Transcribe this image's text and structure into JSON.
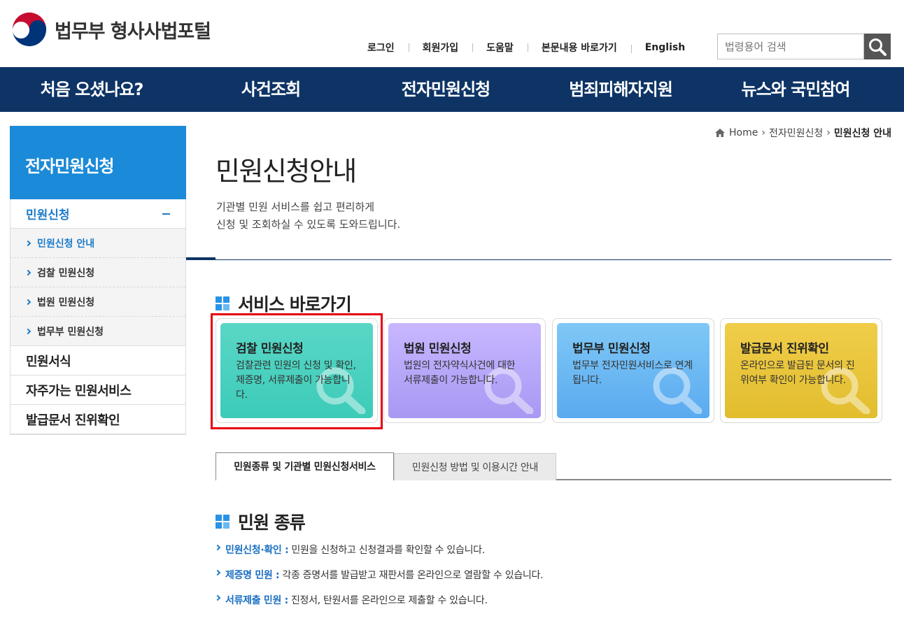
{
  "header": {
    "logo_text": "법무부 형사사법포털",
    "util_links": [
      "로그인",
      "회원가입",
      "도움말",
      "본문내용 바로가기",
      "English"
    ],
    "search_placeholder": "법령용어 검색"
  },
  "gnb": [
    "처음 오셨나요?",
    "사건조회",
    "전자민원신청",
    "범죄피해자지원",
    "뉴스와 국민참여"
  ],
  "sidebar": {
    "title": "전자민원신청",
    "group_label": "민원신청",
    "sub_items": [
      "민원신청 안내",
      "검찰 민원신청",
      "법원 민원신청",
      "법무부 민원신청"
    ],
    "main_items": [
      "민원서식",
      "자주가는 민원서비스",
      "발급문서 진위확인"
    ]
  },
  "breadcrumb": {
    "home": "Home",
    "level1": "전자민원신청",
    "current": "민원신청 안내"
  },
  "page": {
    "title": "민원신청안내",
    "desc_line1": "기관별 민원 서비스를 쉽고 편리하게",
    "desc_line2": "신청 및 조회하실 수 있도록 도와드립니다."
  },
  "services": {
    "section_title": "서비스 바로가기",
    "cards": [
      {
        "title": "검찰 민원신청",
        "desc": "검찰관련 민원의 신청 및 확인, 제증명, 서류제출이 가능합니다."
      },
      {
        "title": "법원 민원신청",
        "desc": "법원의 전자약식사건에 대한 서류제출이 가능합니다."
      },
      {
        "title": "법무부 민원신청",
        "desc": "법무부 전자민원서비스로 연계됩니다."
      },
      {
        "title": "발급문서 진위확인",
        "desc": "온라인으로 발급된 문서의 진위여부 확인이 가능합니다."
      }
    ]
  },
  "tabs": [
    "민원종류 및 기관별 민원신청서비스",
    "민원신청 방법 및 이용시간 안내"
  ],
  "kinds": {
    "section_title": "민원 종류",
    "items": [
      {
        "term": "민원신청·확인 :",
        "desc": "민원을 신청하고 신청결과를 확인할 수 있습니다."
      },
      {
        "term": "제증명 민원 :",
        "desc": "각종 증명서를 발급받고 재판서를 온라인으로 열람할 수 있습니다."
      },
      {
        "term": "서류제출 민원 :",
        "desc": "진정서, 탄원서를 온라인으로 제출할 수 있습니다."
      }
    ]
  },
  "colors": {
    "navy": "#0e3466",
    "sidebar_blue": "#1b8ad8",
    "highlight_red": "#e60012"
  }
}
